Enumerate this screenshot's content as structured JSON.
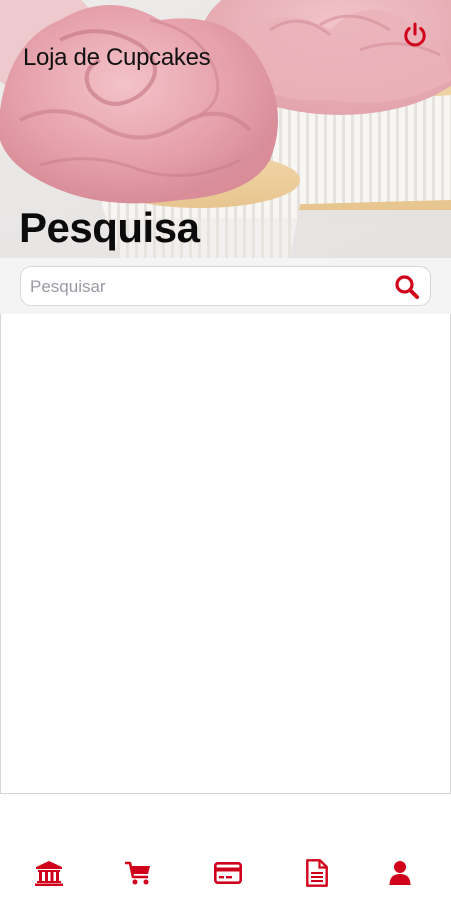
{
  "header": {
    "app_title": "Loja de Cupcakes",
    "page_title": "Pesquisa",
    "hero_image": "cupcakes-photo"
  },
  "search": {
    "placeholder": "Pesquisar",
    "value": "",
    "icon": "search-icon"
  },
  "icons": {
    "power": "power-icon"
  },
  "bottom_nav": {
    "items": [
      {
        "icon": "bank-icon"
      },
      {
        "icon": "cart-icon"
      },
      {
        "icon": "credit-card-icon"
      },
      {
        "icon": "document-icon"
      },
      {
        "icon": "user-icon"
      }
    ]
  },
  "colors": {
    "accent": "#d0021b",
    "frosting": "#e8aab3",
    "search_bar_bg": "#f4f4f4"
  }
}
